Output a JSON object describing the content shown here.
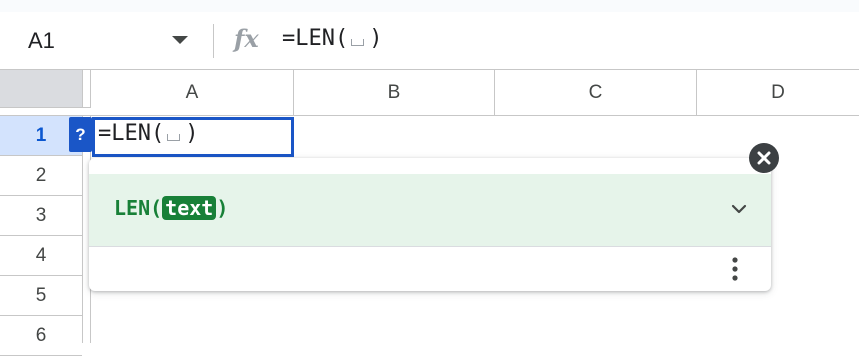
{
  "formula_bar": {
    "name_box": "A1",
    "fx_label": "fx",
    "formula_prefix": "=LEN(",
    "formula_suffix": ")"
  },
  "columns": [
    "A",
    "B",
    "C",
    "D"
  ],
  "rows": [
    "1",
    "2",
    "3",
    "4",
    "5",
    "6"
  ],
  "active_cell": {
    "ref": "A1",
    "text_prefix": "=LEN(",
    "text_suffix": ")",
    "help_button": "?"
  },
  "formula_help": {
    "function_name": "LEN(",
    "argument": "text",
    "close_paren": ")",
    "expand_icon": "chevron-down-icon",
    "more_icon": "more-vert-icon",
    "close_icon": "close-icon"
  },
  "colors": {
    "selection": "#1a56c7",
    "help_header_bg": "#e6f4ea",
    "help_text": "#188038"
  }
}
